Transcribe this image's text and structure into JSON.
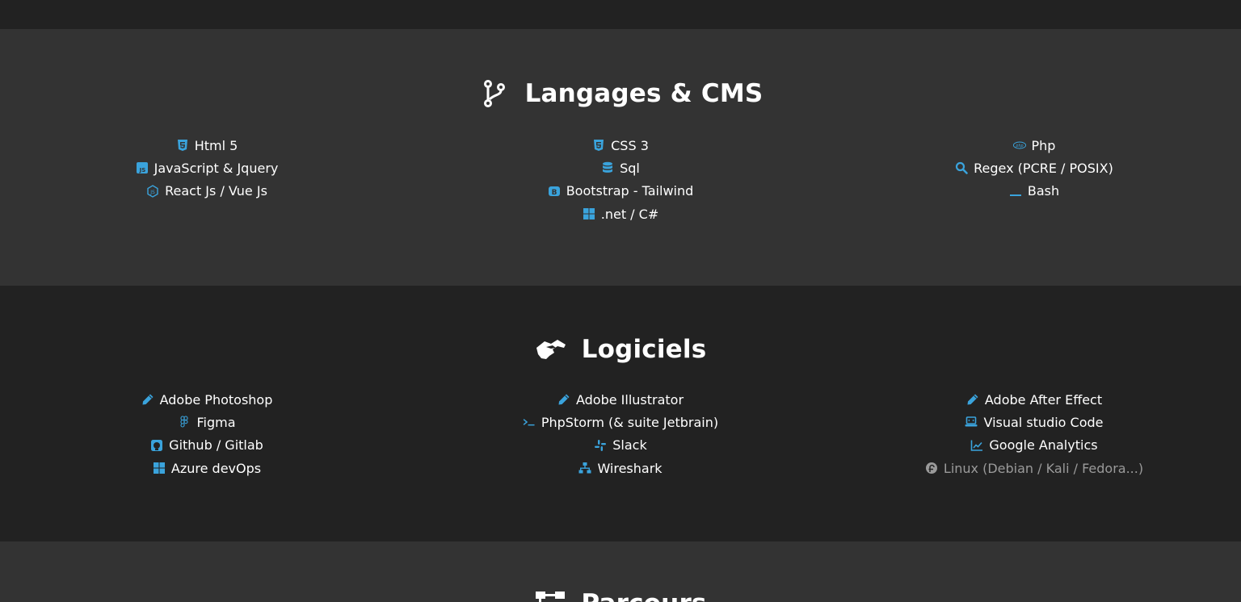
{
  "colors": {
    "accent": "#3aa3dc",
    "bg_dark": "#222222",
    "bg_light": "#333333",
    "text": "#ffffff",
    "muted": "#9a9a9a"
  },
  "languages": {
    "title": "Langages & CMS",
    "icon": "code-branch-icon",
    "columns": [
      [
        {
          "label": "Html 5",
          "icon": "html5-icon"
        },
        {
          "label": "JavaScript & Jquery",
          "icon": "js-square-icon"
        },
        {
          "label": "React Js / Vue Js",
          "icon": "node-js-icon"
        }
      ],
      [
        {
          "label": "CSS 3",
          "icon": "css3-icon"
        },
        {
          "label": "Sql",
          "icon": "database-icon"
        },
        {
          "label": "Bootstrap - Tailwind",
          "icon": "bootstrap-icon"
        },
        {
          "label": ".net / C#",
          "icon": "windows-icon"
        }
      ],
      [
        {
          "label": "Php",
          "icon": "php-icon"
        },
        {
          "label": "Regex (PCRE / POSIX)",
          "icon": "search-icon"
        },
        {
          "label": "Bash",
          "icon": "underscore-icon"
        }
      ]
    ]
  },
  "software": {
    "title": "Logiciels",
    "icon": "handshake-icon",
    "columns": [
      [
        {
          "label": "Adobe Photoshop",
          "icon": "pencil-icon"
        },
        {
          "label": "Figma",
          "icon": "figma-icon"
        },
        {
          "label": "Github / Gitlab",
          "icon": "github-square-icon"
        },
        {
          "label": "Azure devOps",
          "icon": "windows-icon"
        }
      ],
      [
        {
          "label": "Adobe Illustrator",
          "icon": "pencil-icon"
        },
        {
          "label": "PhpStorm (& suite Jetbrain)",
          "icon": "terminal-icon"
        },
        {
          "label": "Slack",
          "icon": "slack-icon"
        },
        {
          "label": "Wireshark",
          "icon": "network-icon"
        }
      ],
      [
        {
          "label": "Adobe After Effect",
          "icon": "pencil-icon"
        },
        {
          "label": "Visual studio Code",
          "icon": "laptop-code-icon"
        },
        {
          "label": "Google Analytics",
          "icon": "chart-line-icon"
        },
        {
          "label": "Linux (Debian / Kali / Fedora...)",
          "icon": "fedora-icon",
          "muted": true
        }
      ]
    ]
  },
  "parcours": {
    "title": "Parcours",
    "icon": "sitemap-icon"
  }
}
